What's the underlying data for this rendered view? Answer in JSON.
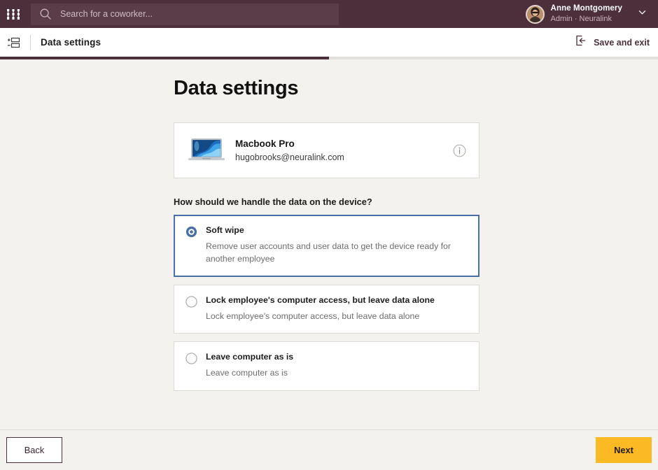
{
  "topbar": {
    "logo_name": "brand-logo",
    "search": {
      "icon": "search-icon",
      "placeholder": "Search for a coworker...",
      "value": ""
    },
    "user": {
      "name": "Anne Montgomery",
      "role": "Admin · Neuralink",
      "avatar_name": "user-avatar",
      "chevron": "chevron-down-icon"
    }
  },
  "subheader": {
    "panel_icon": "panel-list-icon",
    "title": "Data settings",
    "save_and_exit_label": "Save and exit",
    "save_and_exit_icon": "exit-icon",
    "progress_percent": 50
  },
  "main": {
    "page_title": "Data settings",
    "device": {
      "thumb_icon": "macbook-icon",
      "name": "Macbook Pro",
      "email": "hugobrooks@neuralink.com",
      "info_icon": "info-icon"
    },
    "question": "How should we handle the data on the device?",
    "options": [
      {
        "title": "Soft wipe",
        "description": "Remove user accounts and user data to get the device ready for another employee",
        "selected": true
      },
      {
        "title": "Lock employee's computer access, but leave data alone",
        "description": "Lock employee's computer access, but leave data alone",
        "selected": false
      },
      {
        "title": "Leave computer as is",
        "description": "Leave computer as is",
        "selected": false
      }
    ]
  },
  "footer": {
    "back_label": "Back",
    "next_label": "Next"
  },
  "colors": {
    "brand_maroon": "#4c2f3b",
    "accent_yellow": "#fbb924",
    "selected_blue": "#4a6fa5",
    "page_bg": "#f4f2ef"
  }
}
